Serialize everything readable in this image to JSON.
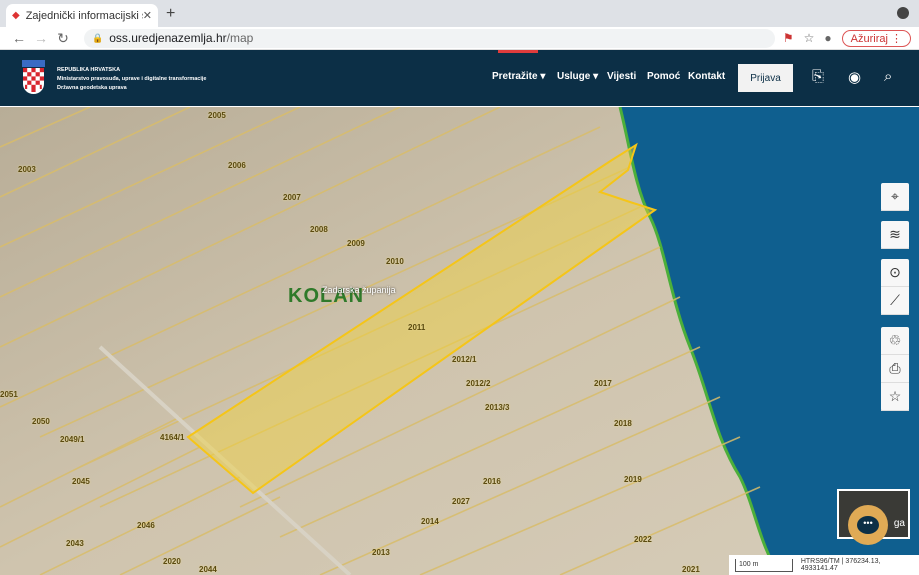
{
  "browser": {
    "tab_title": "Zajednički informacijski sustav",
    "url_host": "oss.uredjenazemlja.hr",
    "url_path": "/map",
    "update_label": "Ažuriraj"
  },
  "header": {
    "line1": "REPUBLIKA HRVATSKA",
    "line2": "Ministarstvo pravosuđa, uprave i digitalne transformacije",
    "line3": "Državna geodetska uprava",
    "nav": [
      "Pretražite",
      "Usluge",
      "Vijesti",
      "Pomoć",
      "Kontakt"
    ],
    "login": "Prijava"
  },
  "map": {
    "place": "KOLAN",
    "region": "Zadarska županija",
    "parcels": [
      "2005",
      "2003",
      "2006",
      "2007",
      "2008",
      "2009",
      "2010",
      "2011",
      "2012/1",
      "2012/2",
      "2013/3",
      "2017",
      "2018",
      "2019",
      "2016",
      "2027",
      "2014",
      "2022",
      "2013",
      "4164/1",
      "2049/1",
      "2050",
      "2051",
      "2045",
      "2046",
      "2043",
      "2044",
      "2020",
      "2021"
    ],
    "scale": "100 m",
    "coords": "HTRS96/TM | 376234.13, 4933141.47",
    "minimap_label": "ga"
  },
  "colors": {
    "header": "#0c2f46",
    "sea": "#0f5f8f",
    "highlight": "#f2d23a"
  }
}
